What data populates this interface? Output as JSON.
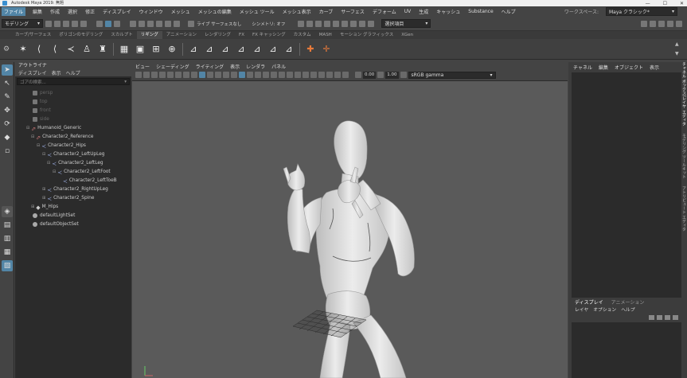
{
  "window": {
    "title": "Autodesk Maya 2019: 無題",
    "controls": [
      "—",
      "☐",
      "✕"
    ]
  },
  "menubar": [
    "ファイル",
    "編集",
    "作成",
    "選択",
    "修正",
    "ディスプレイ",
    "ウィンドウ",
    "メッシュ",
    "メッシュの編集",
    "メッシュ ツール",
    "メッシュ表示",
    "カーブ",
    "サーフェス",
    "デフォーム",
    "UV",
    "生成",
    "キャッシュ",
    "Substance",
    "ヘルプ"
  ],
  "workspace": {
    "label": "ワークスペース:",
    "value": "Maya クラシック*"
  },
  "statusline": {
    "mode": "モデリング",
    "symmetry": "シンメトリ: オフ",
    "live_surface": "ライブ サーフェスなし",
    "render_select": "選択項目"
  },
  "shelf_tabs": [
    "カーブ/サーフェス",
    "ポリゴンのモデリング",
    "スカルプト",
    "リギング",
    "アニメーション",
    "レンダリング",
    "FX",
    "FX キャッシング",
    "カスタム",
    "MASH",
    "モーション グラフィックス",
    "XGen"
  ],
  "shelf_selected": "リギング",
  "outliner": {
    "title": "アウトライナ",
    "menus": [
      "ディスプレイ",
      "表示",
      "ヘルプ"
    ],
    "search_placeholder": "ゴアの検索...",
    "cameras": [
      "persp",
      "top",
      "front",
      "side"
    ],
    "nodes": [
      {
        "label": "Humanoid_Generic",
        "depth": 0,
        "icon": "group"
      },
      {
        "label": "Character2_Reference",
        "depth": 1,
        "icon": "joint-ref"
      },
      {
        "label": "Character2_Hips",
        "depth": 2,
        "icon": "joint"
      },
      {
        "label": "Character2_LeftUpLeg",
        "depth": 3,
        "icon": "joint"
      },
      {
        "label": "Character2_LeftLeg",
        "depth": 4,
        "icon": "joint"
      },
      {
        "label": "Character2_LeftFoot",
        "depth": 5,
        "icon": "joint"
      },
      {
        "label": "Character2_LeftToeB",
        "depth": 6,
        "icon": "joint"
      },
      {
        "label": "Character2_RightUpLeg",
        "depth": 3,
        "icon": "joint"
      },
      {
        "label": "Character2_Spine",
        "depth": 3,
        "icon": "joint"
      },
      {
        "label": "M_Hips",
        "depth": 1,
        "icon": "mesh"
      },
      {
        "label": "defaultLightSet",
        "depth": 0,
        "icon": "set"
      },
      {
        "label": "defaultObjectSet",
        "depth": 0,
        "icon": "set"
      }
    ]
  },
  "viewport": {
    "menus": [
      "ビュー",
      "シェーディング",
      "ライティング",
      "表示",
      "レンダラ",
      "パネル"
    ],
    "exposure": "0.00",
    "gamma": "1.00",
    "colorspace": "sRGB gamma"
  },
  "channelbox": {
    "menus": [
      "チャネル",
      "編集",
      "オブジェクト",
      "表示"
    ],
    "layer_tabs": [
      "ディスプレイ",
      "アニメーション"
    ],
    "layer_menus": [
      "レイヤ",
      "オプション",
      "ヘルプ"
    ]
  },
  "side_tabs": [
    "チャネル ボックス/レイヤ エディタ",
    "モデリング ツールキット",
    "アトリビュート エディタ"
  ],
  "colors": {
    "accent": "#5285a6",
    "panel": "#444444",
    "dark": "#2b2b2b",
    "viewport": "#5a5a5a"
  }
}
